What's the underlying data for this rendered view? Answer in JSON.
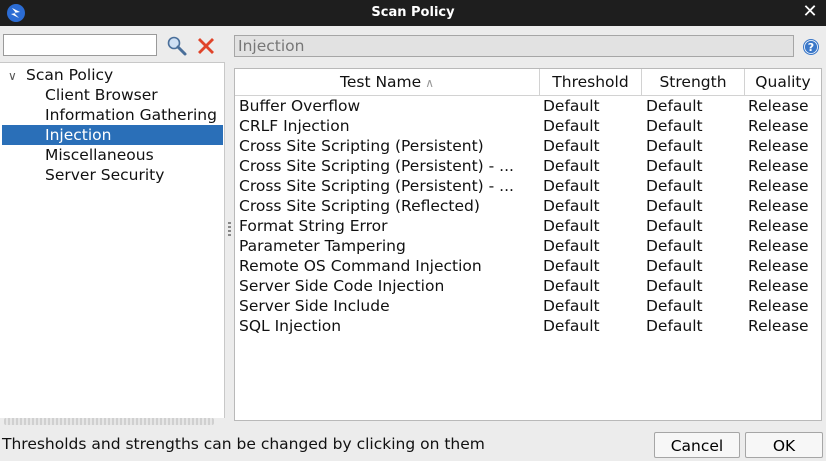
{
  "window": {
    "title": "Scan Policy"
  },
  "left": {
    "search": {
      "value": "",
      "placeholder": ""
    },
    "tree": {
      "root": "Scan Policy",
      "children": [
        "Client Browser",
        "Information Gathering",
        "Injection",
        "Miscellaneous",
        "Server Security"
      ],
      "selected": "Injection"
    }
  },
  "right": {
    "category": "Injection",
    "table": {
      "columns": [
        "Test Name",
        "Threshold",
        "Strength",
        "Quality"
      ],
      "rows": [
        [
          "Buffer Overflow",
          "Default",
          "Default",
          "Release"
        ],
        [
          "CRLF Injection",
          "Default",
          "Default",
          "Release"
        ],
        [
          "Cross Site Scripting (Persistent)",
          "Default",
          "Default",
          "Release"
        ],
        [
          "Cross Site Scripting (Persistent) - ...",
          "Default",
          "Default",
          "Release"
        ],
        [
          "Cross Site Scripting (Persistent) - ...",
          "Default",
          "Default",
          "Release"
        ],
        [
          "Cross Site Scripting (Reflected)",
          "Default",
          "Default",
          "Release"
        ],
        [
          "Format String Error",
          "Default",
          "Default",
          "Release"
        ],
        [
          "Parameter Tampering",
          "Default",
          "Default",
          "Release"
        ],
        [
          "Remote OS Command Injection",
          "Default",
          "Default",
          "Release"
        ],
        [
          "Server Side Code Injection",
          "Default",
          "Default",
          "Release"
        ],
        [
          "Server Side Include",
          "Default",
          "Default",
          "Release"
        ],
        [
          "SQL Injection",
          "Default",
          "Default",
          "Release"
        ]
      ]
    }
  },
  "footer": {
    "hint": "Thresholds and strengths can be changed by clicking on them",
    "cancel_label": "Cancel",
    "ok_label": "OK"
  },
  "colors": {
    "selection": "#2a6fb8",
    "titlebar": "#1e1e1e",
    "clear_icon": "#e0442a"
  }
}
